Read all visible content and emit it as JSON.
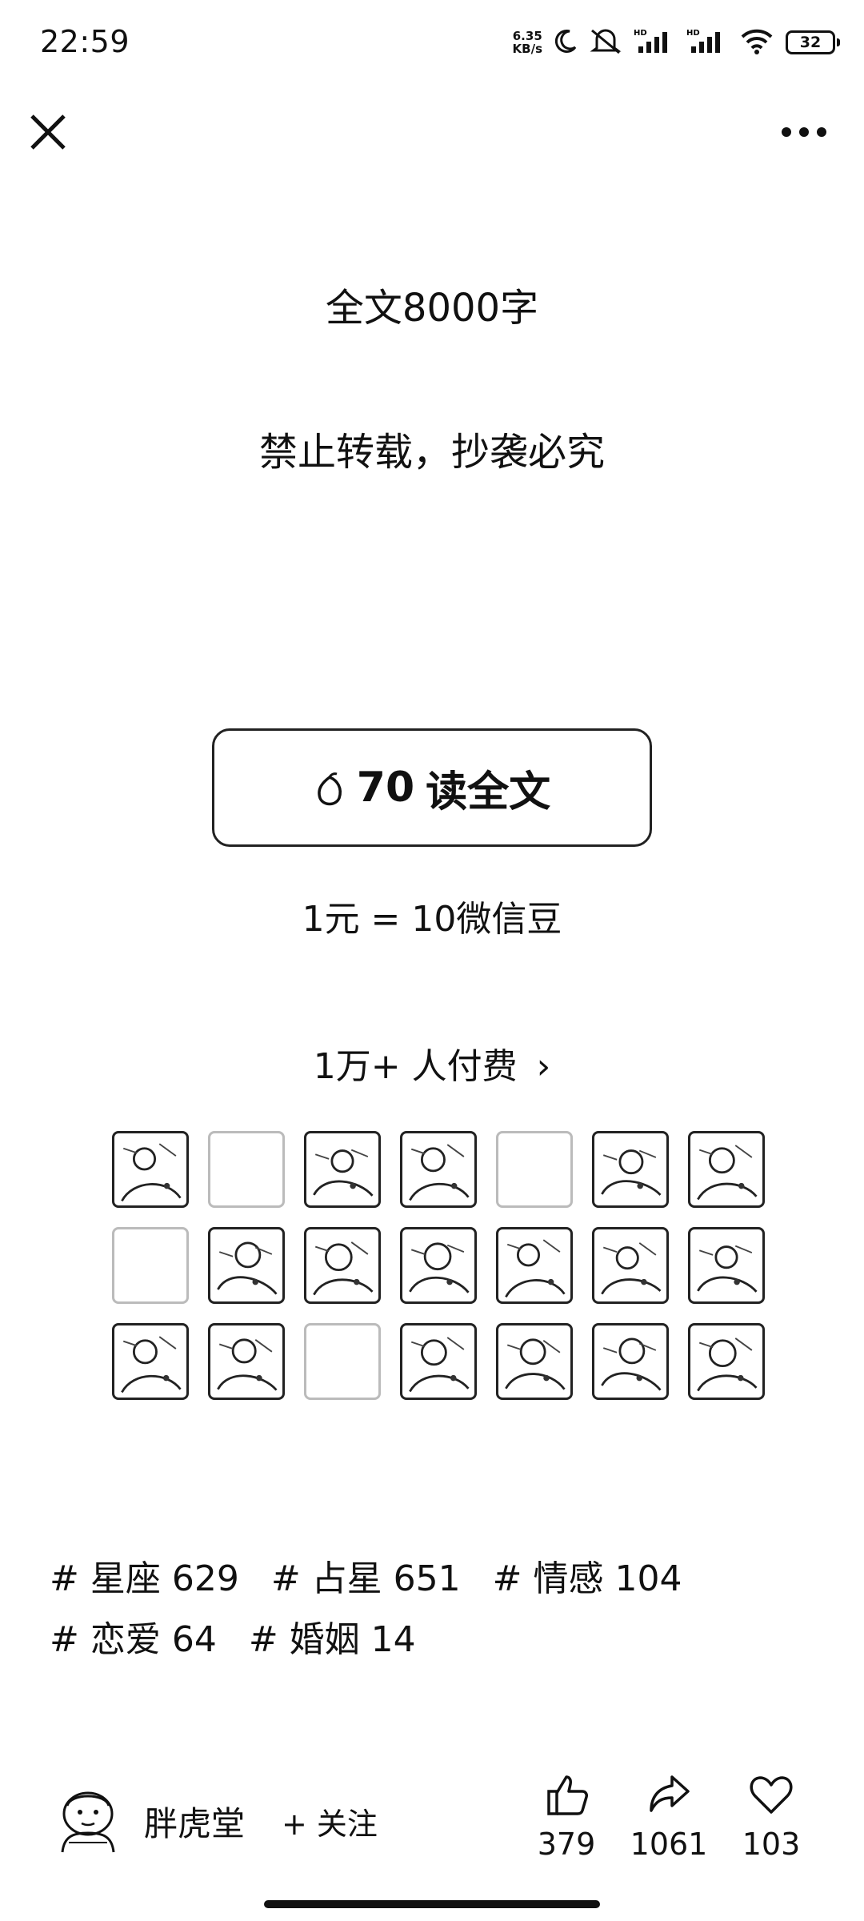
{
  "status_bar": {
    "time": "22:59",
    "net_speed_value": "6.35",
    "net_speed_unit": "KB/s",
    "battery": "32",
    "icons": [
      "moon-icon",
      "mute-icon",
      "signal-hd-icon",
      "signal-hd-icon",
      "wifi-icon",
      "battery-icon"
    ]
  },
  "nav": {
    "close_icon": "close-icon",
    "more_icon": "more-icon"
  },
  "article": {
    "headline": "全文8000字",
    "notice": "禁止转载，抄袭必究"
  },
  "paywall": {
    "price": "70",
    "action_label": "读全文",
    "rate": "1元 = 10微信豆",
    "payers_label": "1万+ 人付费",
    "chevron": "›"
  },
  "avatars": {
    "count": 21,
    "empty_indices": [
      1,
      4,
      7,
      16
    ]
  },
  "tags": [
    {
      "label": "# 星座 629"
    },
    {
      "label": "# 占星 651"
    },
    {
      "label": "# 情感 104"
    },
    {
      "label": "# 恋爱 64"
    },
    {
      "label": "# 婚姻 14"
    }
  ],
  "author": {
    "name": "胖虎堂",
    "follow_label": "+ 关注"
  },
  "actions": {
    "like_count": "379",
    "share_count": "1061",
    "favorite_count": "103"
  }
}
